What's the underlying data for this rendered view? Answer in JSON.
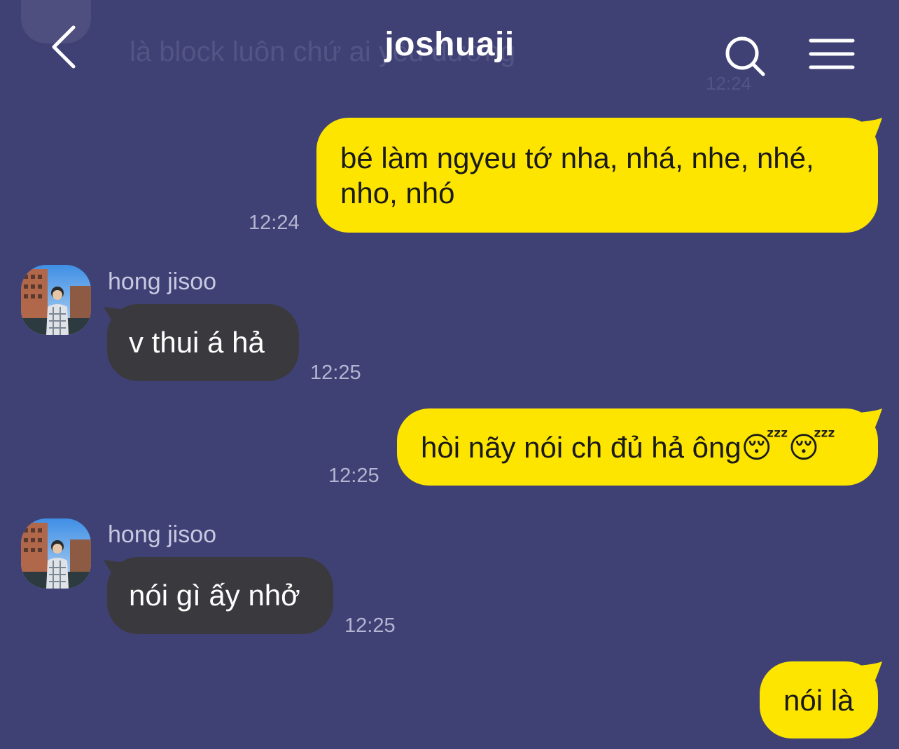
{
  "header": {
    "title": "joshuaji",
    "ghost_message": "là block luôn chứ ai yêu đương",
    "ghost_time": "12:24"
  },
  "messages": [
    {
      "direction": "out",
      "text": "bé làm ngyeu tớ nha, nhá, nhe, nhé, nho, nhó",
      "time": "12:24"
    },
    {
      "direction": "in",
      "sender": "hong jisoo",
      "text": "v thui á hả",
      "time": "12:25"
    },
    {
      "direction": "out",
      "text": "hòi nãy nói ch đủ hả ông😴😴",
      "time": "12:25"
    },
    {
      "direction": "in",
      "sender": "hong jisoo",
      "text": "nói gì ấy nhở",
      "time": "12:25"
    },
    {
      "direction": "out",
      "text": "nói là",
      "time": ""
    }
  ],
  "colors": {
    "background": "#3f4175",
    "outgoing_bubble": "#fde500",
    "incoming_bubble": "#3a3a3e"
  },
  "icons": {
    "back": "chevron-left-icon",
    "search": "search-icon",
    "menu": "hamburger-menu-icon"
  }
}
